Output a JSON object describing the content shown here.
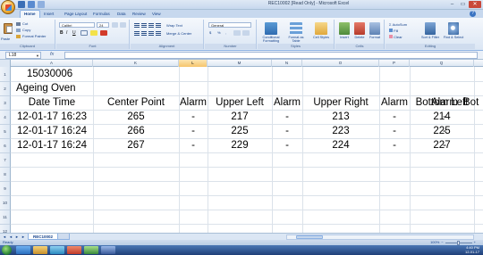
{
  "window": {
    "title": "REC10002 [Read Only] - Microsoft Excel",
    "minimize": "–",
    "maximize": "▭",
    "close": "✕"
  },
  "ribbon_tabs": [
    "Home",
    "Insert",
    "Page Layout",
    "Formulas",
    "Data",
    "Review",
    "View"
  ],
  "ribbon": {
    "clipboard": {
      "paste": "Paste",
      "cut": "Cut",
      "copy": "Copy",
      "format_painter": "Format Painter",
      "label": "Clipboard"
    },
    "font": {
      "name": "Calibri",
      "size": "24",
      "bold": "B",
      "italic": "I",
      "underline": "U",
      "label": "Font"
    },
    "alignment": {
      "wrap": "Wrap Text",
      "merge": "Merge & Center",
      "label": "Alignment"
    },
    "number": {
      "format": "General",
      "currency": "$",
      "percent": "%",
      "comma": ",",
      "label": "Number"
    },
    "styles": {
      "conditional": "Conditional Formatting",
      "table": "Format as Table",
      "cell": "Cell Styles",
      "label": "Styles"
    },
    "cells": {
      "insert": "Insert",
      "delete": "Delete",
      "format": "Format",
      "label": "Cells"
    },
    "editing": {
      "autosum": "AutoSum",
      "fill": "Fill",
      "clear": "Clear",
      "sort": "Sort & Filter",
      "find": "Find & Select",
      "label": "Editing"
    }
  },
  "formula_bar": {
    "name_box": "L18",
    "fx": "fx",
    "value": ""
  },
  "columns": [
    "A",
    "K",
    "L",
    "M",
    "N",
    "O",
    "P",
    "Q",
    "R"
  ],
  "selected_column": "L",
  "row_numbers": [
    "1",
    "2",
    "3",
    "4",
    "5",
    "6",
    "7",
    "8",
    "9",
    "10",
    "11",
    "12"
  ],
  "sheet": {
    "id": "15030006",
    "name": "Ageing Oven",
    "headers": [
      "Date Time",
      "Center Point",
      "Alarm",
      "Upper Left",
      "Alarm",
      "Upper Right",
      "Alarm",
      "Bottom Left",
      "Alarm",
      "Bot"
    ],
    "rows": [
      [
        "12-01-17 16:23",
        "265",
        "-",
        "217",
        "-",
        "213",
        "-",
        "214",
        "-"
      ],
      [
        "12-01-17 16:24",
        "266",
        "-",
        "225",
        "-",
        "223",
        "-",
        "225",
        "-"
      ],
      [
        "12-01-17 16:24",
        "267",
        "-",
        "229",
        "-",
        "224",
        "-",
        "227",
        "-"
      ]
    ]
  },
  "sheet_tabs": [
    "REC10002"
  ],
  "status": {
    "ready": "Ready",
    "zoom": "100%"
  },
  "taskbar": {
    "time": "4:40 PM",
    "date": "12-01-17"
  }
}
